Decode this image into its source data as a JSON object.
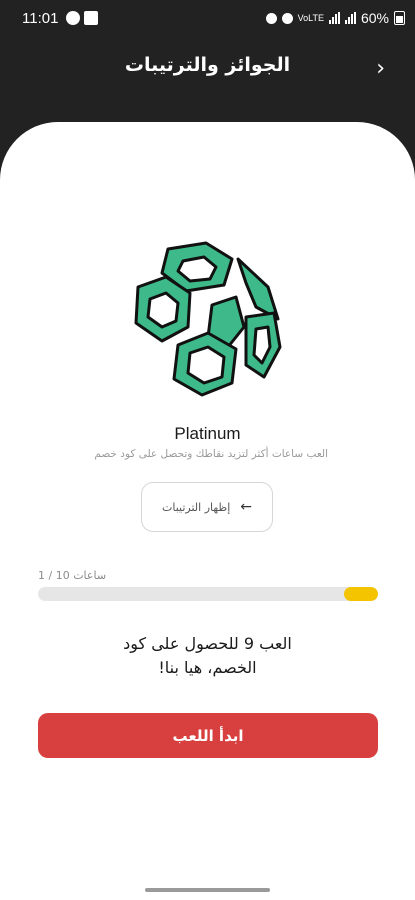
{
  "status_bar": {
    "time": "11:01",
    "battery": "60%",
    "network_text": "VoLTE"
  },
  "header": {
    "title": "الجوائز والترتيبات",
    "back_icon": "chevron-right-icon"
  },
  "tier": {
    "name": "Platinum",
    "description": "العب ساعات أكثر لتزيد نقاطك وتحصل على كود خصم",
    "badge_color": "#3DB98A"
  },
  "rankings_button": {
    "label": "إظهار الترتيبات",
    "icon": "arrow-left-icon"
  },
  "progress": {
    "label": "1 / 10 ساعات",
    "current": 1,
    "target": 10,
    "fill_color": "#F5C400"
  },
  "motivation": {
    "line1": "العب 9 للحصول على كود",
    "line2": "الخصم، هيا بنا!"
  },
  "start_button": {
    "label": "ابدأ اللعب",
    "color": "#D8403F"
  }
}
